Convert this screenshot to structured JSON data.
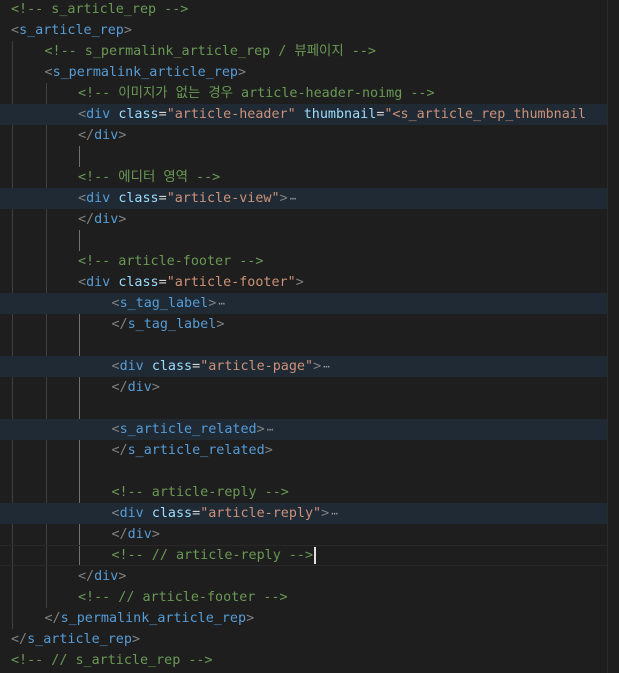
{
  "editor": {
    "lines": [
      {
        "indent": 0,
        "tokens": [
          {
            "t": "c",
            "v": "<!-- s_article_rep -->"
          }
        ]
      },
      {
        "indent": 0,
        "tokens": [
          {
            "t": "b",
            "v": "<"
          },
          {
            "t": "g",
            "v": "s_article_rep"
          },
          {
            "t": "b",
            "v": ">"
          }
        ]
      },
      {
        "indent": 1,
        "tokens": [
          {
            "t": "c",
            "v": "<!-- s_permalink_article_rep / 뷰페이지 -->"
          }
        ]
      },
      {
        "indent": 1,
        "tokens": [
          {
            "t": "b",
            "v": "<"
          },
          {
            "t": "g",
            "v": "s_permalink_article_rep"
          },
          {
            "t": "b",
            "v": ">"
          }
        ]
      },
      {
        "indent": 2,
        "tokens": [
          {
            "t": "c",
            "v": "<!-- 이미지가 없는 경우 article-header-noimg -->"
          }
        ]
      },
      {
        "indent": 2,
        "hl": true,
        "tokens": [
          {
            "t": "b",
            "v": "<"
          },
          {
            "t": "g",
            "v": "div"
          },
          {
            "t": "x",
            "v": " "
          },
          {
            "t": "a",
            "v": "class"
          },
          {
            "t": "x",
            "v": "="
          },
          {
            "t": "s",
            "v": "\"article-header\""
          },
          {
            "t": "x",
            "v": " "
          },
          {
            "t": "a",
            "v": "thumbnail"
          },
          {
            "t": "x",
            "v": "="
          },
          {
            "t": "s",
            "v": "\"<s_article_rep_thumbnail"
          }
        ]
      },
      {
        "indent": 2,
        "tokens": [
          {
            "t": "b",
            "v": "</"
          },
          {
            "t": "g",
            "v": "div"
          },
          {
            "t": "b",
            "v": ">"
          }
        ]
      },
      {
        "indent": 0,
        "tokens": []
      },
      {
        "indent": 2,
        "tokens": [
          {
            "t": "c",
            "v": "<!-- 에디터 영역 -->"
          }
        ]
      },
      {
        "indent": 2,
        "hl": true,
        "fold": true,
        "tokens": [
          {
            "t": "b",
            "v": "<"
          },
          {
            "t": "g",
            "v": "div"
          },
          {
            "t": "x",
            "v": " "
          },
          {
            "t": "a",
            "v": "class"
          },
          {
            "t": "x",
            "v": "="
          },
          {
            "t": "s",
            "v": "\"article-view\""
          },
          {
            "t": "b",
            "v": ">"
          }
        ]
      },
      {
        "indent": 2,
        "tokens": [
          {
            "t": "b",
            "v": "</"
          },
          {
            "t": "g",
            "v": "div"
          },
          {
            "t": "b",
            "v": ">"
          }
        ]
      },
      {
        "indent": 0,
        "tokens": []
      },
      {
        "indent": 2,
        "tokens": [
          {
            "t": "c",
            "v": "<!-- article-footer -->"
          }
        ]
      },
      {
        "indent": 2,
        "tokens": [
          {
            "t": "b",
            "v": "<"
          },
          {
            "t": "g",
            "v": "div"
          },
          {
            "t": "x",
            "v": " "
          },
          {
            "t": "a",
            "v": "class"
          },
          {
            "t": "x",
            "v": "="
          },
          {
            "t": "s",
            "v": "\"article-footer\""
          },
          {
            "t": "b",
            "v": ">"
          }
        ]
      },
      {
        "indent": 3,
        "hl": true,
        "fold": true,
        "tokens": [
          {
            "t": "b",
            "v": "<"
          },
          {
            "t": "g",
            "v": "s_tag_label"
          },
          {
            "t": "b",
            "v": ">"
          }
        ]
      },
      {
        "indent": 3,
        "tokens": [
          {
            "t": "b",
            "v": "</"
          },
          {
            "t": "g",
            "v": "s_tag_label"
          },
          {
            "t": "b",
            "v": ">"
          }
        ]
      },
      {
        "indent": 0,
        "tokens": []
      },
      {
        "indent": 3,
        "hl": true,
        "fold": true,
        "tokens": [
          {
            "t": "b",
            "v": "<"
          },
          {
            "t": "g",
            "v": "div"
          },
          {
            "t": "x",
            "v": " "
          },
          {
            "t": "a",
            "v": "class"
          },
          {
            "t": "x",
            "v": "="
          },
          {
            "t": "s",
            "v": "\"article-page\""
          },
          {
            "t": "b",
            "v": ">"
          }
        ]
      },
      {
        "indent": 3,
        "tokens": [
          {
            "t": "b",
            "v": "</"
          },
          {
            "t": "g",
            "v": "div"
          },
          {
            "t": "b",
            "v": ">"
          }
        ]
      },
      {
        "indent": 0,
        "tokens": []
      },
      {
        "indent": 3,
        "hl": true,
        "fold": true,
        "tokens": [
          {
            "t": "b",
            "v": "<"
          },
          {
            "t": "g",
            "v": "s_article_related"
          },
          {
            "t": "b",
            "v": ">"
          }
        ]
      },
      {
        "indent": 3,
        "tokens": [
          {
            "t": "b",
            "v": "</"
          },
          {
            "t": "g",
            "v": "s_article_related"
          },
          {
            "t": "b",
            "v": ">"
          }
        ]
      },
      {
        "indent": 0,
        "tokens": []
      },
      {
        "indent": 3,
        "tokens": [
          {
            "t": "c",
            "v": "<!-- article-reply -->"
          }
        ]
      },
      {
        "indent": 3,
        "hl": true,
        "fold": true,
        "tokens": [
          {
            "t": "b",
            "v": "<"
          },
          {
            "t": "g",
            "v": "div"
          },
          {
            "t": "x",
            "v": " "
          },
          {
            "t": "a",
            "v": "class"
          },
          {
            "t": "x",
            "v": "="
          },
          {
            "t": "s",
            "v": "\"article-reply\""
          },
          {
            "t": "b",
            "v": ">"
          }
        ]
      },
      {
        "indent": 3,
        "tokens": [
          {
            "t": "b",
            "v": "</"
          },
          {
            "t": "g",
            "v": "div"
          },
          {
            "t": "b",
            "v": ">"
          }
        ]
      },
      {
        "indent": 3,
        "cursor": true,
        "tokens": [
          {
            "t": "c",
            "v": "<!-- // article-reply -->"
          }
        ]
      },
      {
        "indent": 2,
        "tokens": [
          {
            "t": "b",
            "v": "</"
          },
          {
            "t": "g",
            "v": "div"
          },
          {
            "t": "b",
            "v": ">"
          }
        ]
      },
      {
        "indent": 2,
        "tokens": [
          {
            "t": "c",
            "v": "<!-- // article-footer -->"
          }
        ]
      },
      {
        "indent": 1,
        "tokens": [
          {
            "t": "b",
            "v": "</"
          },
          {
            "t": "g",
            "v": "s_permalink_article_rep"
          },
          {
            "t": "b",
            "v": ">"
          }
        ]
      },
      {
        "indent": 0,
        "tokens": [
          {
            "t": "b",
            "v": "</"
          },
          {
            "t": "g",
            "v": "s_article_rep"
          },
          {
            "t": "b",
            "v": ">"
          }
        ]
      },
      {
        "indent": 0,
        "tokens": [
          {
            "t": "c",
            "v": "<!-- // s_article_rep -->"
          }
        ]
      }
    ],
    "fold_glyph": "⋯",
    "colors": {
      "background": "#1e1e1e",
      "comment": "#6a9955",
      "tag": "#569cd6",
      "attribute": "#9cdcfe",
      "string": "#ce9178",
      "bracket": "#808080",
      "highlight": "#1f2a35"
    }
  }
}
